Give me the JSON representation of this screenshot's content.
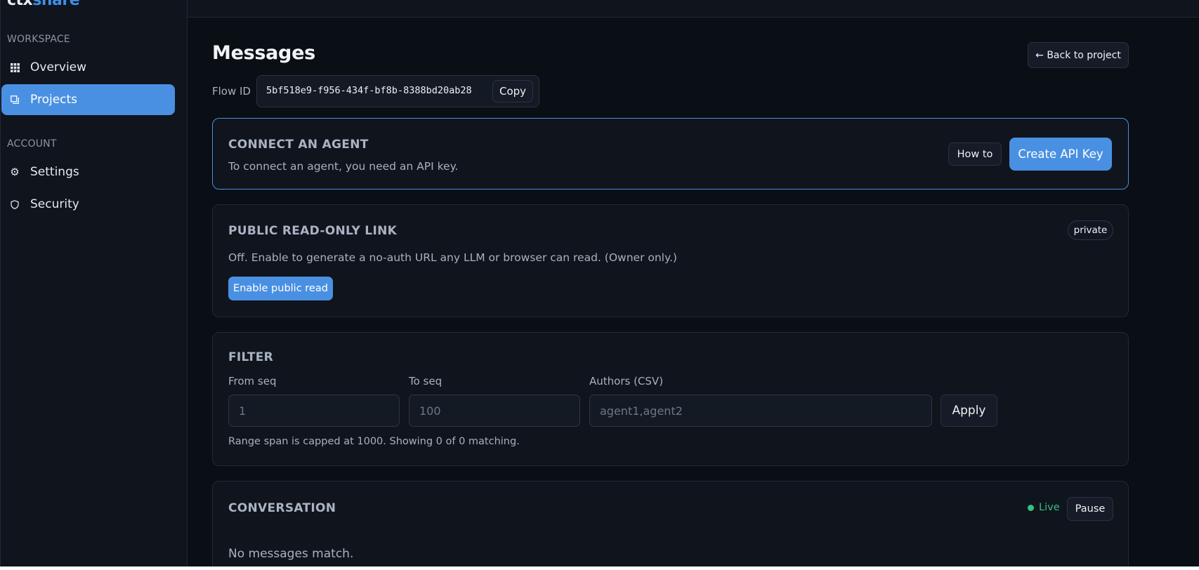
{
  "brand": {
    "part1": "ctx",
    "part2": "share",
    "accent": "#4a90e2"
  },
  "sidebar": {
    "sections": [
      {
        "label": "WORKSPACE"
      },
      {
        "label": "ACCOUNT"
      }
    ],
    "items": [
      {
        "label": "Overview",
        "icon": "grid-icon",
        "active": false
      },
      {
        "label": "Projects",
        "icon": "folder-icon",
        "active": true
      },
      {
        "label": "Settings",
        "icon": "gear-icon",
        "active": false
      },
      {
        "label": "Security",
        "icon": "shield-icon",
        "active": false
      }
    ]
  },
  "header": {
    "title": "Messages",
    "back_label": "← Back to project",
    "flow_label": "Flow ID",
    "flow_id": "5bf518e9-f956-434f-bf8b-8388bd20ab28",
    "copy_label": "Copy"
  },
  "connect": {
    "title": "CONNECT AN AGENT",
    "text": "To connect an agent, you need an API key.",
    "howto_label": "How to",
    "create_label": "Create API Key"
  },
  "public_link": {
    "title": "PUBLIC READ-ONLY LINK",
    "badge": "private",
    "text": "Off. Enable to generate a no-auth URL any LLM or browser can read. (Owner only.)",
    "enable_label": "Enable public read"
  },
  "filter": {
    "title": "FILTER",
    "from_label": "From seq",
    "from_placeholder": "1",
    "from_value": "",
    "to_label": "To seq",
    "to_placeholder": "100",
    "to_value": "",
    "authors_label": "Authors (CSV)",
    "authors_placeholder": "agent1,agent2",
    "authors_value": "",
    "apply_label": "Apply",
    "note": "Range span is capped at 1000. Showing 0 of 0 matching."
  },
  "conversation": {
    "title": "CONVERSATION",
    "status": "Live",
    "status_color": "#35c27a",
    "pause_label": "Pause",
    "empty_text": "No messages match."
  }
}
